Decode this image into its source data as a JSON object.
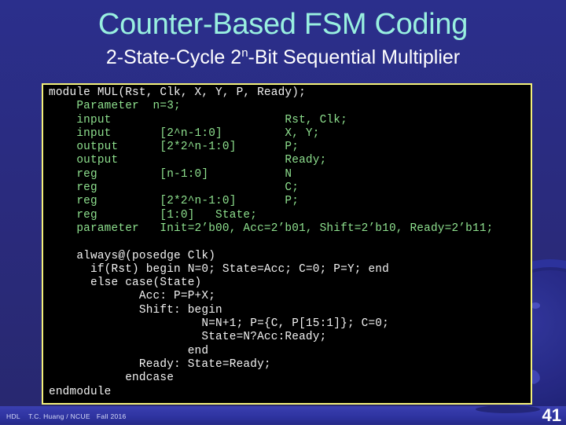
{
  "slide": {
    "title": "Counter-Based FSM Coding",
    "subtitle_prefix": "2-State-Cycle 2",
    "subtitle_superscript": "n",
    "subtitle_suffix": "-Bit Sequential Multiplier",
    "colors": {
      "title": "#99f0e0",
      "subtitle": "#ffffff",
      "background": "#2a2b7e",
      "code_background": "#000000",
      "code_border": "#f3f07a",
      "code_text_white": "#f2f2f2",
      "code_text_green": "#8ee08e"
    }
  },
  "code": {
    "lines": [
      {
        "text": "module MUL(Rst, Clk, X, Y, P, Ready);",
        "color": "white"
      },
      {
        "text": "    Parameter  n=3;",
        "color": "green"
      },
      {
        "text": "    input                         Rst, Clk;",
        "color": "green"
      },
      {
        "text": "    input       [2^n-1:0]         X, Y;",
        "color": "green"
      },
      {
        "text": "    output      [2*2^n-1:0]       P;",
        "color": "green"
      },
      {
        "text": "    output                        Ready;",
        "color": "green"
      },
      {
        "text": "    reg         [n-1:0]           N",
        "color": "green"
      },
      {
        "text": "    reg                           C;",
        "color": "green"
      },
      {
        "text": "    reg         [2*2^n-1:0]       P;",
        "color": "green"
      },
      {
        "text": "    reg         [1:0]   State;",
        "color": "green"
      },
      {
        "text": "    parameter   Init=2’b00, Acc=2’b01, Shift=2’b10, Ready=2’b11;",
        "color": "green"
      },
      {
        "text": "",
        "color": "white"
      },
      {
        "text": "    always@(posedge Clk)",
        "color": "white"
      },
      {
        "text": "      if(Rst) begin N=0; State=Acc; C=0; P=Y; end",
        "color": "white"
      },
      {
        "text": "      else case(State)",
        "color": "white"
      },
      {
        "text": "             Acc: P=P+X;",
        "color": "white"
      },
      {
        "text": "             Shift: begin",
        "color": "white"
      },
      {
        "text": "                      N=N+1; P={C, P[15:1]}; C=0;",
        "color": "white"
      },
      {
        "text": "                      State=N?Acc:Ready;",
        "color": "white"
      },
      {
        "text": "                    end",
        "color": "white"
      },
      {
        "text": "             Ready: State=Ready;",
        "color": "white"
      },
      {
        "text": "           endcase",
        "color": "white"
      },
      {
        "text": "endmodule",
        "color": "white"
      }
    ]
  },
  "footer": {
    "course": "HDL",
    "author": "T.C. Huang / NCUE",
    "term": "Fall 2016",
    "page_number": "41"
  }
}
